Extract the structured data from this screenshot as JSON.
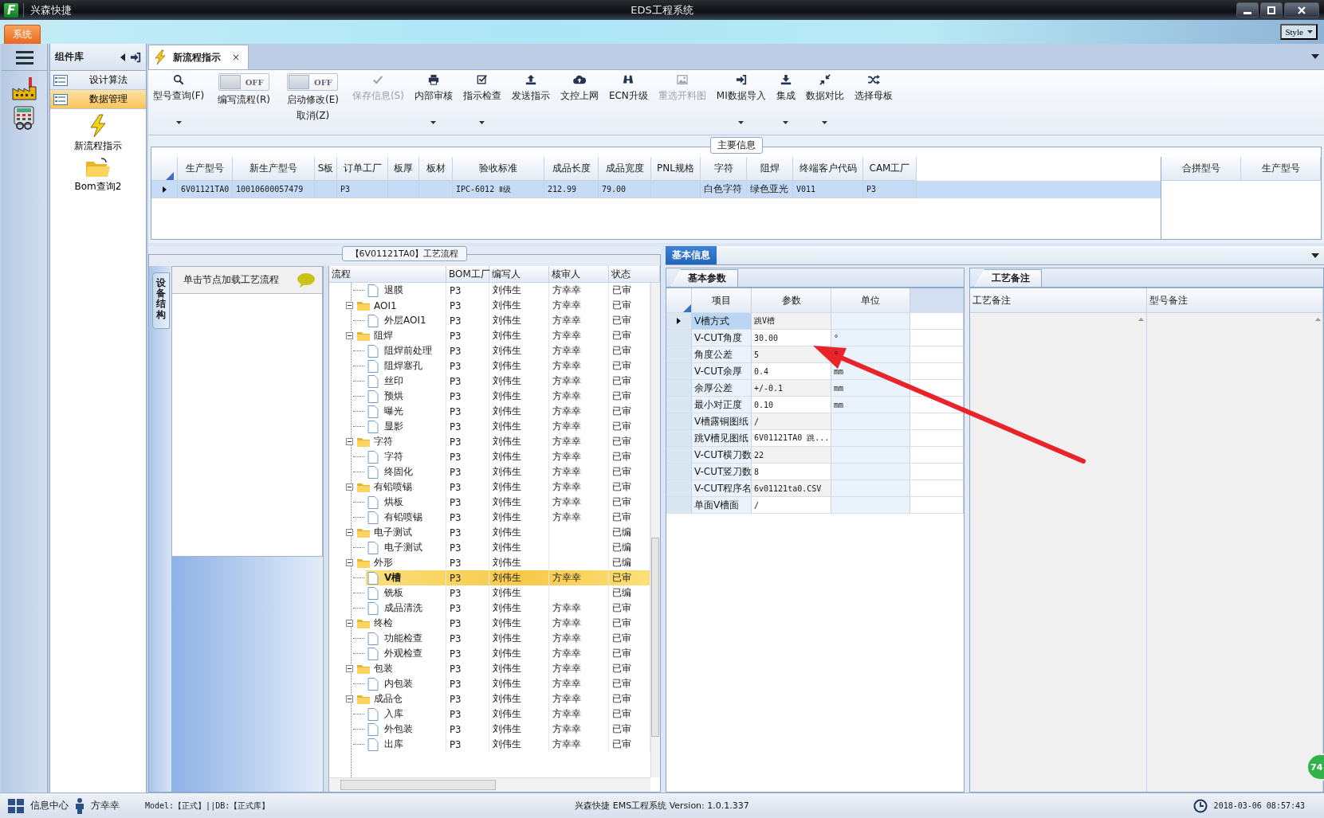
{
  "window": {
    "logo": "F",
    "app_name": "兴森快捷",
    "title": "EDS工程系统"
  },
  "menu": {
    "tabs": [
      {
        "label": "系统",
        "selected": true
      }
    ],
    "style_label": "Style"
  },
  "component_panel": {
    "title": "组件库",
    "groups": [
      {
        "label": "设计算法",
        "selected": false
      },
      {
        "label": "数据管理",
        "selected": true
      }
    ],
    "items": [
      {
        "kind": "bolt",
        "label": "新流程指示"
      },
      {
        "kind": "folder",
        "label": "Bom查询2"
      }
    ]
  },
  "doc_tabs": [
    {
      "label": "新流程指示",
      "selected": true,
      "close": "×"
    }
  ],
  "toolbar": [
    {
      "kind": "button",
      "label": "型号查询(F)",
      "dropdown": true,
      "disabled": false
    },
    {
      "kind": "toggle",
      "label": "编写流程(R)",
      "switch_text": "OFF",
      "on": false
    },
    {
      "kind": "toggle",
      "label": "启动修改(E)",
      "second_label": "取消(Z)",
      "switch_text": "OFF",
      "on": false
    },
    {
      "kind": "button",
      "label": "保存信息(S)",
      "dropdown": false,
      "disabled": true
    },
    {
      "kind": "button",
      "label": "内部审核",
      "dropdown": true,
      "disabled": false
    },
    {
      "kind": "button",
      "label": "指示检查",
      "dropdown": true,
      "disabled": false
    },
    {
      "kind": "button",
      "label": "发送指示",
      "dropdown": false,
      "disabled": false
    },
    {
      "kind": "button",
      "label": "文控上网",
      "dropdown": false,
      "disabled": false
    },
    {
      "kind": "button",
      "label": "ECN升级",
      "dropdown": false,
      "disabled": false
    },
    {
      "kind": "button",
      "label": "重选开料图",
      "dropdown": false,
      "disabled": true
    },
    {
      "kind": "button",
      "label": "MI数据导入",
      "dropdown": true,
      "disabled": false
    },
    {
      "kind": "button",
      "label": "集成",
      "dropdown": true,
      "disabled": false
    },
    {
      "kind": "button",
      "label": "数据对比",
      "dropdown": true,
      "disabled": false
    },
    {
      "kind": "button",
      "label": "选择母板",
      "dropdown": false,
      "disabled": false
    }
  ],
  "main_info": {
    "title": "主要信息",
    "columns": [
      "生产型号",
      "新生产型号",
      "S板",
      "订单工厂",
      "板厚",
      "板材",
      "验收标准",
      "成品长度",
      "成品宽度",
      "PNL规格",
      "字符",
      "阻焊",
      "终端客户代码",
      "CAM工厂"
    ],
    "rows": [
      {
        "selected": true,
        "cells": [
          "6V01121TA0",
          "10010600057479",
          null,
          "P3",
          null,
          null,
          "IPC-6012 Ⅱ级",
          "212.99",
          "79.00",
          null,
          "白色字符",
          "绿色亚光",
          "V011",
          "P3"
        ]
      }
    ],
    "side_columns": [
      "合拼型号",
      "生产型号"
    ]
  },
  "process": {
    "title": "【6V01121TA0】工艺流程",
    "side_tab": "设备结构",
    "hint": "单击节点加载工艺流程",
    "columns": [
      "流程",
      "BOM工厂",
      "编写人",
      "核审人",
      "状态"
    ],
    "tree": [
      {
        "kind": "file",
        "label": "退膜",
        "bom": "P3",
        "author": "刘伟生",
        "reviewer": "方幸幸",
        "status": "已审",
        "selected": false
      },
      {
        "kind": "folder",
        "label": "AOI1",
        "bom": "P3",
        "author": "刘伟生",
        "reviewer": "方幸幸",
        "status": "已审",
        "selected": false,
        "expanded": true,
        "children": [
          {
            "kind": "file",
            "label": "外层AOI1",
            "bom": "P3",
            "author": "刘伟生",
            "reviewer": "方幸幸",
            "status": "已审",
            "selected": false
          }
        ]
      },
      {
        "kind": "folder",
        "label": "阻焊",
        "bom": "P3",
        "author": "刘伟生",
        "reviewer": "方幸幸",
        "status": "已审",
        "selected": false,
        "expanded": true,
        "children": [
          {
            "kind": "file",
            "label": "阻焊前处理",
            "bom": "P3",
            "author": "刘伟生",
            "reviewer": "方幸幸",
            "status": "已审",
            "selected": false
          },
          {
            "kind": "file",
            "label": "阻焊塞孔",
            "bom": "P3",
            "author": "刘伟生",
            "reviewer": "方幸幸",
            "status": "已审",
            "selected": false
          },
          {
            "kind": "file",
            "label": "丝印",
            "bom": "P3",
            "author": "刘伟生",
            "reviewer": "方幸幸",
            "status": "已审",
            "selected": false
          },
          {
            "kind": "file",
            "label": "预烘",
            "bom": "P3",
            "author": "刘伟生",
            "reviewer": "方幸幸",
            "status": "已审",
            "selected": false
          },
          {
            "kind": "file",
            "label": "曝光",
            "bom": "P3",
            "author": "刘伟生",
            "reviewer": "方幸幸",
            "status": "已审",
            "selected": false
          },
          {
            "kind": "file",
            "label": "显影",
            "bom": "P3",
            "author": "刘伟生",
            "reviewer": "方幸幸",
            "status": "已审",
            "selected": false
          }
        ]
      },
      {
        "kind": "folder",
        "label": "字符",
        "bom": "P3",
        "author": "刘伟生",
        "reviewer": "方幸幸",
        "status": "已审",
        "selected": false,
        "expanded": true,
        "children": [
          {
            "kind": "file",
            "label": "字符",
            "bom": "P3",
            "author": "刘伟生",
            "reviewer": "方幸幸",
            "status": "已审",
            "selected": false
          },
          {
            "kind": "file",
            "label": "终固化",
            "bom": "P3",
            "author": "刘伟生",
            "reviewer": "方幸幸",
            "status": "已审",
            "selected": false
          }
        ]
      },
      {
        "kind": "folder",
        "label": "有铅喷锡",
        "bom": "P3",
        "author": "刘伟生",
        "reviewer": "方幸幸",
        "status": "已审",
        "selected": false,
        "expanded": true,
        "children": [
          {
            "kind": "file",
            "label": "烘板",
            "bom": "P3",
            "author": "刘伟生",
            "reviewer": "方幸幸",
            "status": "已审",
            "selected": false
          },
          {
            "kind": "file",
            "label": "有铅喷锡",
            "bom": "P3",
            "author": "刘伟生",
            "reviewer": "方幸幸",
            "status": "已审",
            "selected": false
          }
        ]
      },
      {
        "kind": "folder",
        "label": "电子测试",
        "bom": "P3",
        "author": "刘伟生",
        "status": "已编",
        "selected": false,
        "expanded": true,
        "children": [
          {
            "kind": "file",
            "label": "电子测试",
            "bom": "P3",
            "author": "刘伟生",
            "status": "已编",
            "selected": false
          }
        ]
      },
      {
        "kind": "folder",
        "label": "外形",
        "bom": "P3",
        "author": "刘伟生",
        "status": "已编",
        "selected": false,
        "expanded": true,
        "children": [
          {
            "kind": "file",
            "label": "V槽",
            "bom": "P3",
            "author": "刘伟生",
            "reviewer": "方幸幸",
            "status": "已审",
            "selected": true
          },
          {
            "kind": "file",
            "label": "铣板",
            "bom": "P3",
            "author": "刘伟生",
            "status": "已编",
            "selected": false
          },
          {
            "kind": "file",
            "label": "成品清洗",
            "bom": "P3",
            "author": "刘伟生",
            "reviewer": "方幸幸",
            "status": "已审",
            "selected": false
          }
        ]
      },
      {
        "kind": "folder",
        "label": "终检",
        "bom": "P3",
        "author": "刘伟生",
        "reviewer": "方幸幸",
        "status": "已审",
        "selected": false,
        "expanded": true,
        "children": [
          {
            "kind": "file",
            "label": "功能检查",
            "bom": "P3",
            "author": "刘伟生",
            "reviewer": "方幸幸",
            "status": "已审",
            "selected": false
          },
          {
            "kind": "file",
            "label": "外观检查",
            "bom": "P3",
            "author": "刘伟生",
            "reviewer": "方幸幸",
            "status": "已审",
            "selected": false
          }
        ]
      },
      {
        "kind": "folder",
        "label": "包装",
        "bom": "P3",
        "author": "刘伟生",
        "reviewer": "方幸幸",
        "status": "已审",
        "selected": false,
        "expanded": true,
        "children": [
          {
            "kind": "file",
            "label": "内包装",
            "bom": "P3",
            "author": "刘伟生",
            "reviewer": "方幸幸",
            "status": "已审",
            "selected": false
          }
        ]
      },
      {
        "kind": "folder",
        "label": "成品仓",
        "bom": "P3",
        "author": "刘伟生",
        "reviewer": "方幸幸",
        "status": "已审",
        "selected": false,
        "expanded": true,
        "children": [
          {
            "kind": "file",
            "label": "入库",
            "bom": "P3",
            "author": "刘伟生",
            "reviewer": "方幸幸",
            "status": "已审",
            "selected": false
          },
          {
            "kind": "file",
            "label": "外包装",
            "bom": "P3",
            "author": "刘伟生",
            "reviewer": "方幸幸",
            "status": "已审",
            "selected": false
          },
          {
            "kind": "file",
            "label": "出库",
            "bom": "P3",
            "author": "刘伟生",
            "reviewer": "方幸幸",
            "status": "已审",
            "selected": false
          }
        ]
      }
    ]
  },
  "basic_info": {
    "tab": "基本信息",
    "params": {
      "tab": "基本参数",
      "columns": [
        "项目",
        "参数",
        "单位"
      ],
      "rows": [
        {
          "item": "V槽方式",
          "value": "跳V槽",
          "selected": true
        },
        {
          "item": "V-CUT角度",
          "value": "30.00",
          "unit": "°",
          "selected": false
        },
        {
          "item": "角度公差",
          "value": "5",
          "unit": "°",
          "selected": false
        },
        {
          "item": "V-CUT余厚",
          "value": "0.4",
          "unit": "mm",
          "selected": false
        },
        {
          "item": "余厚公差",
          "value": "+/-0.1",
          "unit": "mm",
          "selected": false
        },
        {
          "item": "最小对正度",
          "value": "0.10",
          "unit": "mm",
          "selected": false
        },
        {
          "item": "V槽露铜图纸",
          "value": "/",
          "selected": false
        },
        {
          "item": "跳V槽见图纸",
          "value": "6V01121TA0 跳...",
          "selected": false
        },
        {
          "item": "V-CUT横刀数",
          "value": "22",
          "selected": false
        },
        {
          "item": "V-CUT竖刀数",
          "value": "8",
          "selected": false
        },
        {
          "item": "V-CUT程序名",
          "value": "6v01121ta0.CSV",
          "selected": false
        },
        {
          "item": "单面V槽面",
          "value": "/",
          "selected": false
        }
      ]
    },
    "notes": {
      "tab": "工艺备注",
      "columns": [
        "工艺备注",
        "型号备注"
      ]
    }
  },
  "annotation": {
    "kind": "arrow"
  },
  "badge": "74",
  "status_bar": {
    "info_center": "信息中心",
    "user": "方幸幸",
    "env": "Model:【正式】||DB:【正式库】",
    "version": "兴森快捷 EMS工程系统 Version: 1.0.1.337",
    "datetime": "2018-03-06 08:57:43"
  }
}
